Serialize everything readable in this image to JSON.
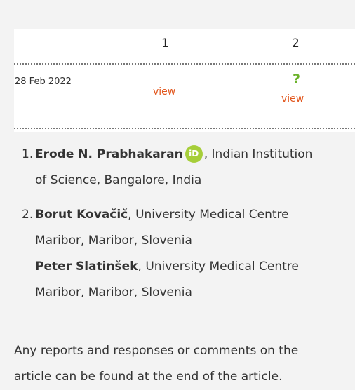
{
  "table": {
    "col1": "1",
    "col2": "2",
    "date": "28 Feb 2022",
    "view1": "view",
    "view2": "view",
    "status_icon": "question-mark-icon",
    "status_glyph": "?"
  },
  "affiliations": [
    {
      "num": "1.",
      "name": "Erode N. Prabhakaran",
      "orcid_label": "iD",
      "affil_line1": ", Indian Institution",
      "affil_line2": "of Science, Bangalore, India"
    },
    {
      "num": "2.",
      "name": "Borut Kovačič",
      "affil_line1": ", University Medical Centre",
      "affil_line2": "Maribor, Maribor, Slovenia",
      "name2": "Peter Slatinšek",
      "affil2_line1": ", University Medical Centre",
      "affil2_line2": "Maribor, Maribor, Slovenia"
    }
  ],
  "footer": {
    "line1": "Any reports and responses or comments on the",
    "line2": "article can be found at the end of the article."
  },
  "colors": {
    "link": "#e2571e",
    "question_mark": "#6bb22a",
    "orcid": "#a6ce39"
  }
}
